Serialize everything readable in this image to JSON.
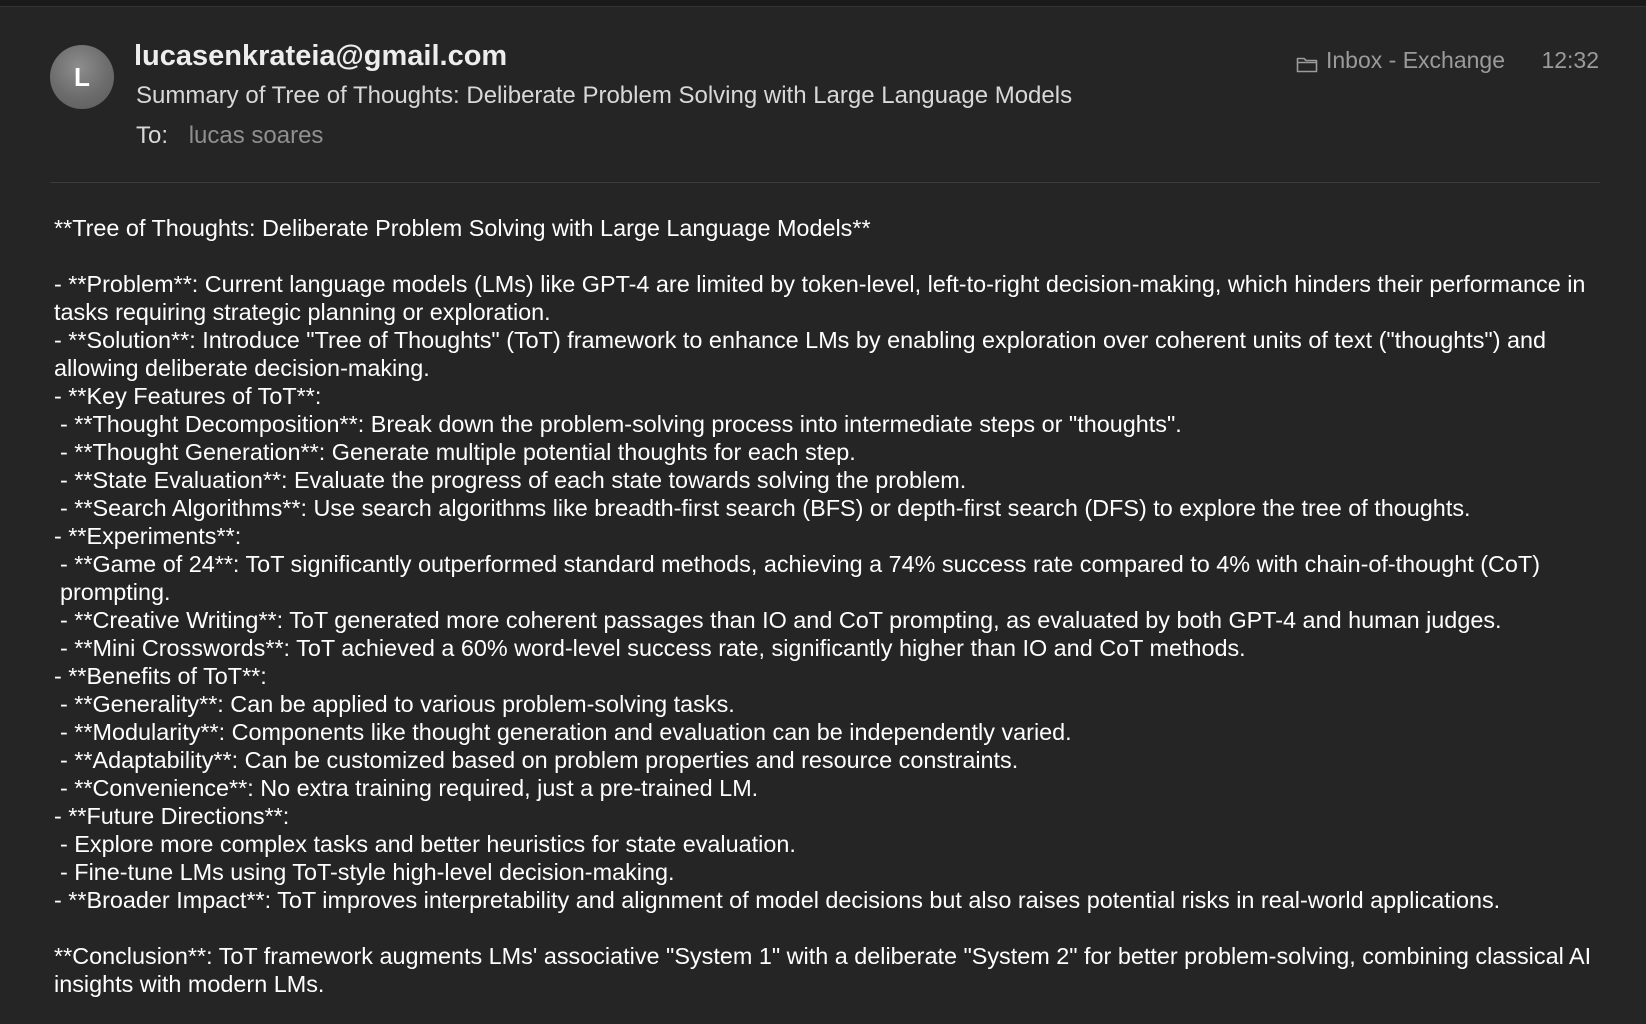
{
  "header": {
    "avatar_initial": "L",
    "sender": "lucasenkrateia@gmail.com",
    "subject": "Summary of Tree of Thoughts: Deliberate Problem Solving with Large Language Models",
    "to_label": "To:",
    "to_value": "lucas soares",
    "mailbox": "Inbox - Exchange",
    "mailbox_icon": "folder-icon",
    "time": "12:32"
  },
  "body": {
    "title": "**Tree of Thoughts: Deliberate Problem Solving with Large Language Models**",
    "lines": [
      "- **Problem**: Current language models (LMs) like GPT-4 are limited by token-level, left-to-right decision-making, which hinders their performance in tasks requiring strategic planning or exploration.",
      "- **Solution**: Introduce \"Tree of Thoughts\" (ToT) framework to enhance LMs by enabling exploration over coherent units of text (\"thoughts\") and allowing deliberate decision-making.",
      "- **Key Features of ToT**:",
      " - **Thought Decomposition**: Break down the problem-solving process into intermediate steps or \"thoughts\".",
      " - **Thought Generation**: Generate multiple potential thoughts for each step.",
      " - **State Evaluation**: Evaluate the progress of each state towards solving the problem.",
      " - **Search Algorithms**: Use search algorithms like breadth-first search (BFS) or depth-first search (DFS) to explore the tree of thoughts.",
      "- **Experiments**:",
      " - **Game of 24**: ToT significantly outperformed standard methods, achieving a 74% success rate compared to 4% with chain-of-thought (CoT) prompting.",
      " - **Creative Writing**: ToT generated more coherent passages than IO and CoT prompting, as evaluated by both GPT-4 and human judges.",
      " - **Mini Crosswords**: ToT achieved a 60% word-level success rate, significantly higher than IO and CoT methods.",
      "- **Benefits of ToT**:",
      " - **Generality**: Can be applied to various problem-solving tasks.",
      " - **Modularity**: Components like thought generation and evaluation can be independently varied.",
      " - **Adaptability**: Can be customized based on problem properties and resource constraints.",
      " - **Convenience**: No extra training required, just a pre-trained LM.",
      "- **Future Directions**:",
      " - Explore more complex tasks and better heuristics for state evaluation.",
      " - Fine-tune LMs using ToT-style high-level decision-making.",
      "- **Broader Impact**: ToT improves interpretability and alignment of model decisions but also raises potential risks in real-world applications."
    ],
    "conclusion": "**Conclusion**: ToT framework augments LMs' associative \"System 1\" with a deliberate \"System 2\" for better problem-solving, combining classical AI insights with modern LMs."
  }
}
